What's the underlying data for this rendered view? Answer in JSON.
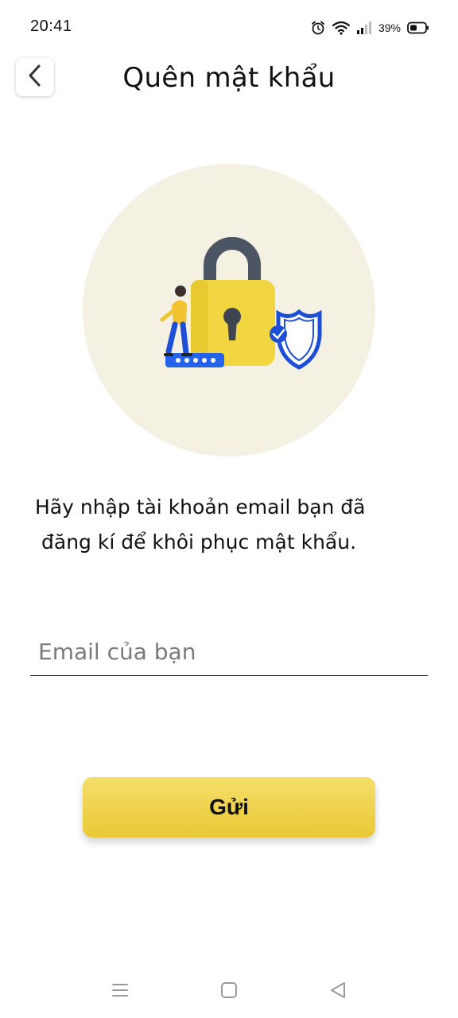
{
  "status_bar": {
    "time": "20:41",
    "battery_percent": "39%",
    "icons": [
      "alarm-icon",
      "wifi-icon",
      "signal-icon",
      "battery-icon"
    ]
  },
  "header": {
    "back_icon": "chevron-left-icon",
    "title": "Quên mật khẩu"
  },
  "illustration": {
    "icon": "padlock-with-shield-illustration",
    "colors": {
      "circle": "#f4f0e2",
      "lock_body": "#f2d641",
      "lock_shackle": "#4b5563",
      "shield": "#1d4ed8"
    }
  },
  "content": {
    "instruction_line1": "Hãy nhập tài khoản email bạn đã",
    "instruction_line2": "đăng kí để khôi phục mật khẩu."
  },
  "form": {
    "email_placeholder": "Email của bạn",
    "email_value": "",
    "submit_label": "Gửi"
  },
  "nav_bar": {
    "items": [
      "menu-icon",
      "home-icon",
      "back-triangle-icon"
    ]
  },
  "colors": {
    "accent": "#eccd3c",
    "text": "#111111",
    "placeholder": "#7a7a7a"
  }
}
